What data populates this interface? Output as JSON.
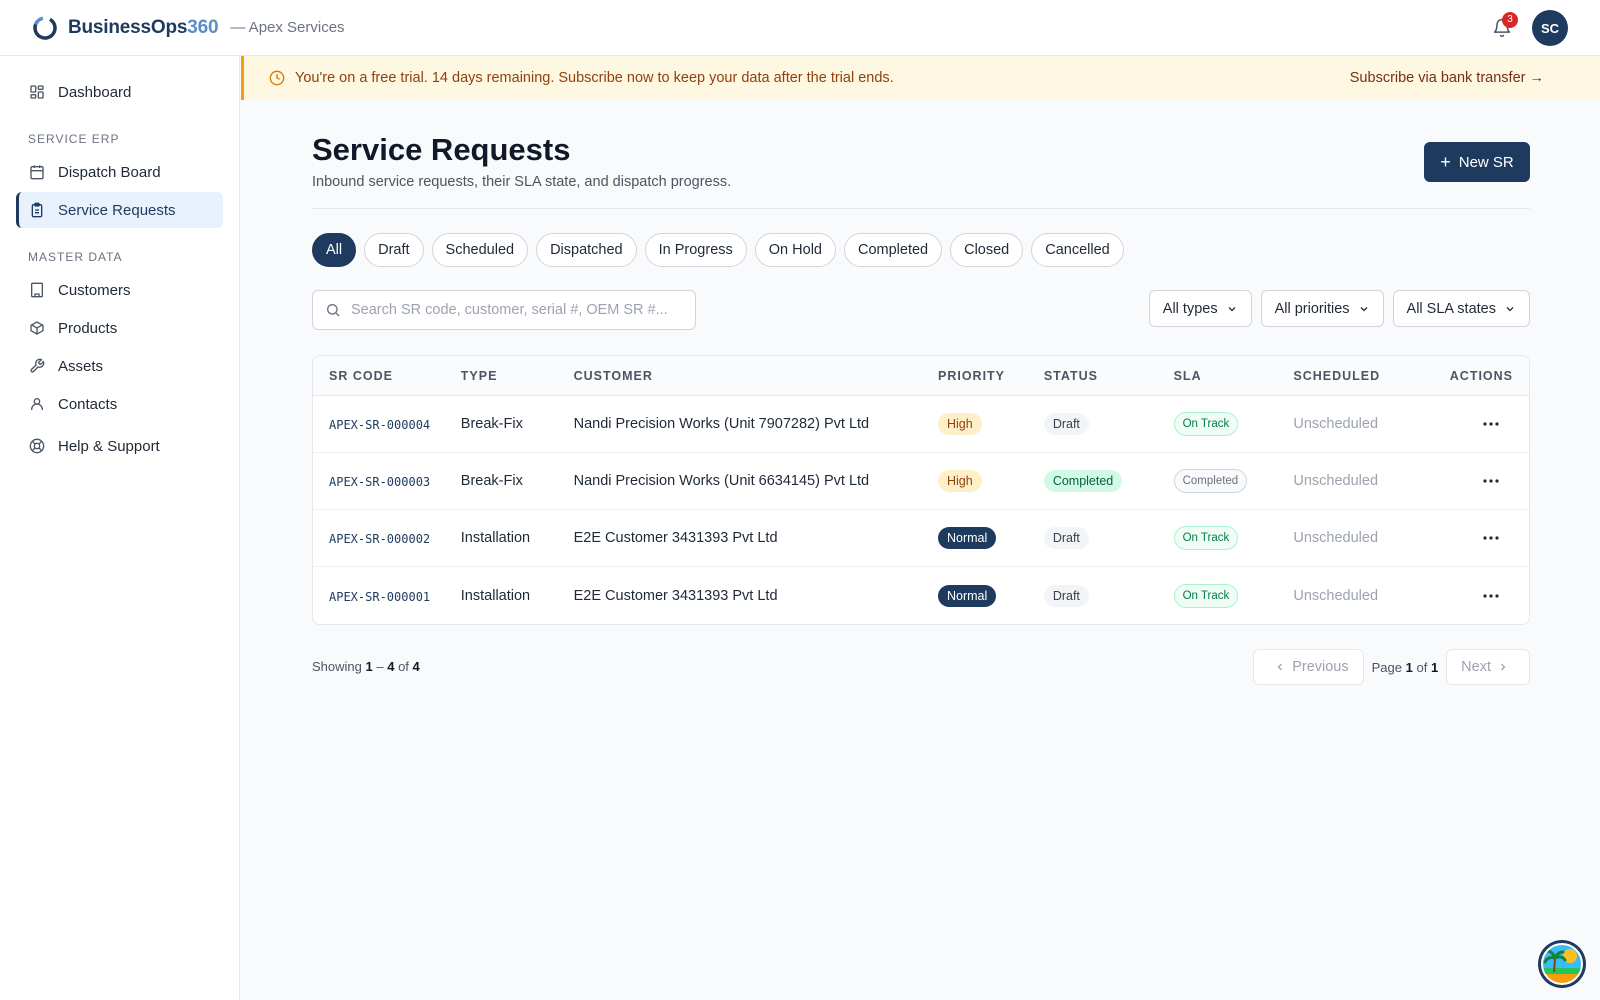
{
  "brand": {
    "name": "BusinessOps",
    "number": "360",
    "org": "— Apex Services"
  },
  "header": {
    "notification_count": "3",
    "avatar_initials": "SC"
  },
  "sidebar": {
    "dashboard": "Dashboard",
    "section_service": "SERVICE ERP",
    "dispatch_board": "Dispatch Board",
    "service_requests": "Service Requests",
    "section_master": "MASTER DATA",
    "customers": "Customers",
    "products": "Products",
    "assets": "Assets",
    "contacts": "Contacts",
    "help": "Help & Support"
  },
  "banner": {
    "text": "You're on a free trial. 14 days remaining. Subscribe now to keep your data after the trial ends.",
    "link": "Subscribe via bank transfer →"
  },
  "page": {
    "title": "Service Requests",
    "subtitle": "Inbound service requests, their SLA state, and dispatch progress.",
    "new_button": "New SR"
  },
  "tabs": [
    "All",
    "Draft",
    "Scheduled",
    "Dispatched",
    "In Progress",
    "On Hold",
    "Completed",
    "Closed",
    "Cancelled"
  ],
  "search": {
    "placeholder": "Search SR code, customer, serial #, OEM SR #..."
  },
  "filters": {
    "types": "All types",
    "priorities": "All priorities",
    "sla": "All SLA states"
  },
  "table": {
    "headers": [
      "SR CODE",
      "TYPE",
      "CUSTOMER",
      "PRIORITY",
      "STATUS",
      "SLA",
      "SCHEDULED",
      "ACTIONS"
    ],
    "rows": [
      {
        "code": "APEX-SR-000004",
        "type": "Break-Fix",
        "customer": "Nandi Precision Works (Unit 7907282) Pvt Ltd",
        "priority": "High",
        "status": "Draft",
        "sla": "On Track",
        "scheduled": "Unscheduled"
      },
      {
        "code": "APEX-SR-000003",
        "type": "Break-Fix",
        "customer": "Nandi Precision Works (Unit 6634145) Pvt Ltd",
        "priority": "High",
        "status": "Completed",
        "sla": "Completed",
        "scheduled": "Unscheduled"
      },
      {
        "code": "APEX-SR-000002",
        "type": "Installation",
        "customer": "E2E Customer 3431393 Pvt Ltd",
        "priority": "Normal",
        "status": "Draft",
        "sla": "On Track",
        "scheduled": "Unscheduled"
      },
      {
        "code": "APEX-SR-000001",
        "type": "Installation",
        "customer": "E2E Customer 3431393 Pvt Ltd",
        "priority": "Normal",
        "status": "Draft",
        "sla": "On Track",
        "scheduled": "Unscheduled"
      }
    ]
  },
  "pagination": {
    "showing_label": "Showing",
    "from": "1",
    "dash": "–",
    "to": "4",
    "of_label": "of",
    "total": "4",
    "previous": "Previous",
    "page_label": "Page",
    "page": "1",
    "page_of": "of",
    "pages": "1",
    "next": "Next"
  },
  "colors": {
    "primary": "#1e3a5f",
    "accent": "#5b8fc7",
    "banner_bg": "#fef7e2",
    "banner_border": "#f59e0b"
  }
}
